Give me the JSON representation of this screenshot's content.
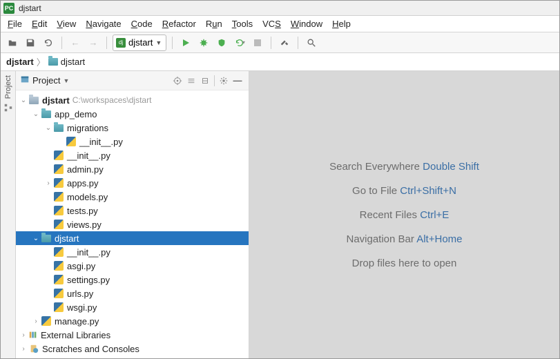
{
  "app": {
    "window_title": "djstart"
  },
  "menu": [
    "File",
    "Edit",
    "View",
    "Navigate",
    "Code",
    "Refactor",
    "Run",
    "Tools",
    "VCS",
    "Window",
    "Help"
  ],
  "toolbar": {
    "run_config_label": "djstart"
  },
  "breadcrumb": {
    "root": "djstart",
    "sub": "djstart"
  },
  "panel": {
    "title": "Project"
  },
  "tree": {
    "root_name": "djstart",
    "root_path": "C:\\workspaces\\djstart",
    "app_demo": "app_demo",
    "migrations": "migrations",
    "migrations_init": "__init__.py",
    "app_init": "__init__.py",
    "admin": "admin.py",
    "apps": "apps.py",
    "models": "models.py",
    "tests": "tests.py",
    "views": "views.py",
    "djstart": "djstart",
    "dj_init": "__init__.py",
    "asgi": "asgi.py",
    "settings": "settings.py",
    "urls": "urls.py",
    "wsgi": "wsgi.py",
    "manage": "manage.py",
    "ext_lib": "External Libraries",
    "scratch": "Scratches and Consoles"
  },
  "hints": {
    "l1a": "Search Everywhere ",
    "l1b": "Double Shift",
    "l2a": "Go to File ",
    "l2b": "Ctrl+Shift+N",
    "l3a": "Recent Files ",
    "l3b": "Ctrl+E",
    "l4a": "Navigation Bar ",
    "l4b": "Alt+Home",
    "l5": "Drop files here to open"
  }
}
